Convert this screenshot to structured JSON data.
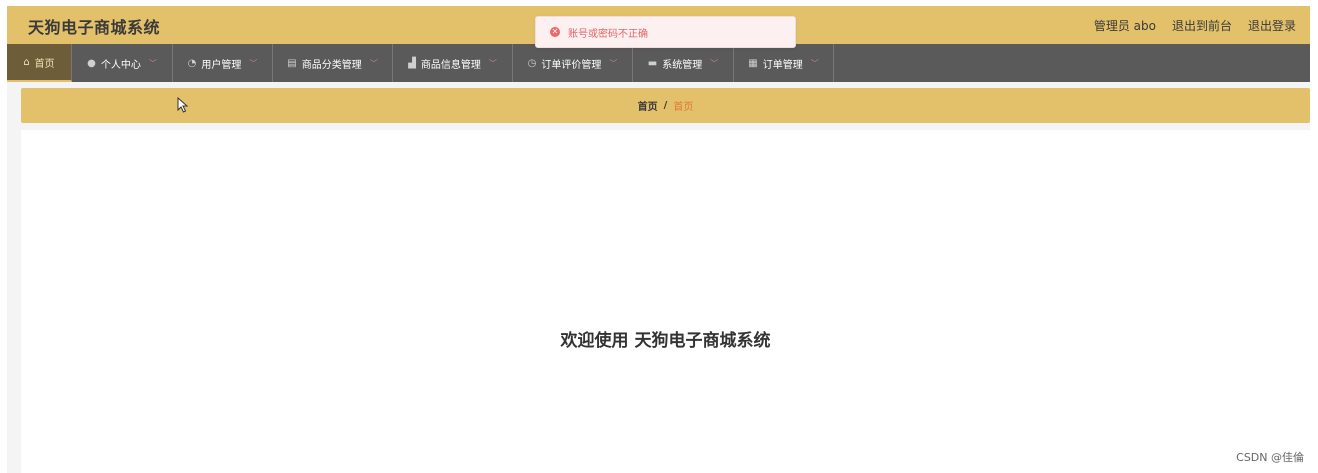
{
  "header": {
    "title": "天狗电子商城系统",
    "user_label": "管理员 abo",
    "back_to_front": "退出到前台",
    "logout": "退出登录"
  },
  "nav": {
    "items": [
      {
        "label": "首页",
        "icon": "home-icon"
      },
      {
        "label": "个人中心",
        "icon": "person-icon"
      },
      {
        "label": "用户管理",
        "icon": "dashboard-icon"
      },
      {
        "label": "商品分类管理",
        "icon": "clipboard-icon"
      },
      {
        "label": "商品信息管理",
        "icon": "chart-icon"
      },
      {
        "label": "订单评价管理",
        "icon": "clock-icon"
      },
      {
        "label": "系统管理",
        "icon": "monitor-icon"
      },
      {
        "label": "订单管理",
        "icon": "grid-icon"
      }
    ]
  },
  "breadcrumb": {
    "home": "首页",
    "separator": "/",
    "current": "首页"
  },
  "main": {
    "welcome": "欢迎使用 天狗电子商城系统"
  },
  "toast": {
    "message": "账号或密码不正确",
    "icon": "error-icon"
  },
  "watermark": "CSDN @佳倫",
  "colors": {
    "accent": "#e3c16b",
    "nav_bg": "#5a5a5a",
    "breadcrumb_current": "#e0783a",
    "error": "#ee6666"
  }
}
